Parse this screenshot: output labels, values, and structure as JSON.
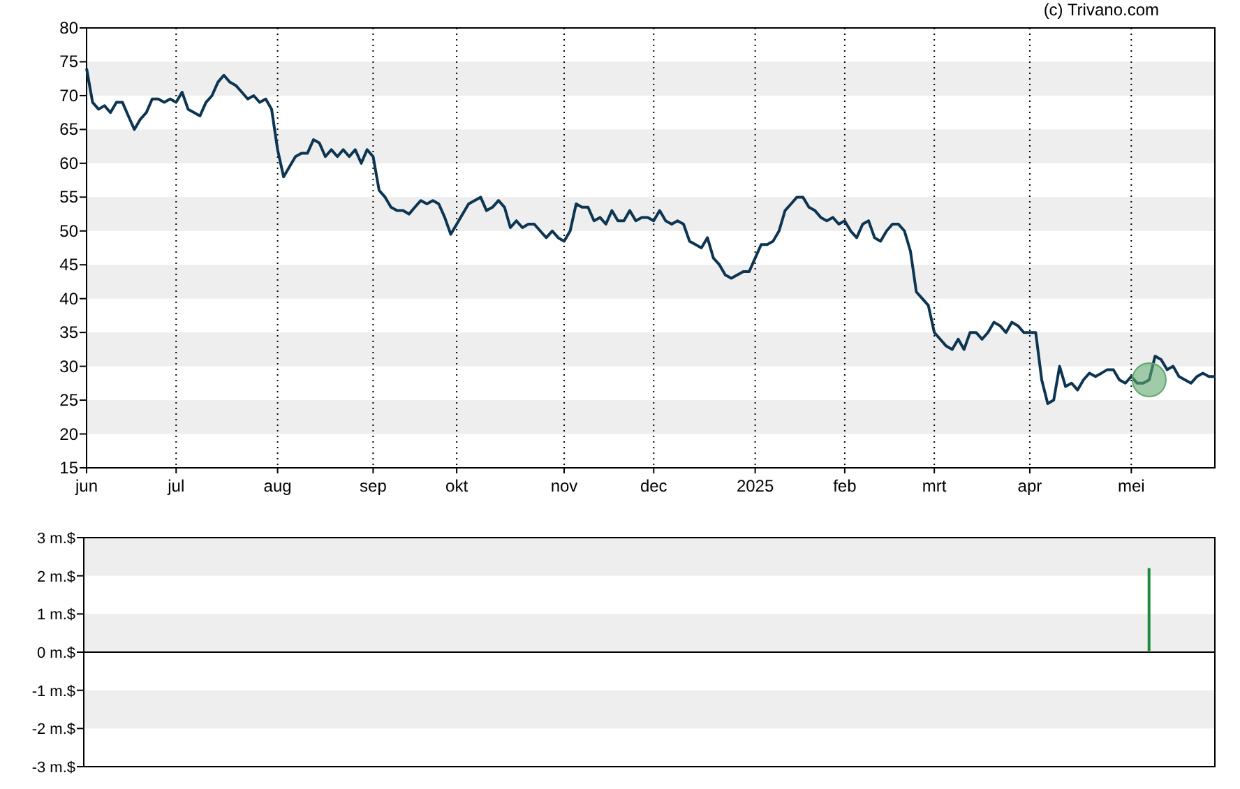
{
  "credit": "(c) Trivano.com",
  "price_chart": {
    "chart_data": {
      "type": "line",
      "ylim": [
        15,
        80
      ],
      "categories": [
        "jun",
        null,
        null,
        null,
        null,
        null,
        null,
        null,
        null,
        null,
        null,
        null,
        null,
        null,
        null,
        "jul",
        null,
        null,
        null,
        null,
        null,
        null,
        null,
        null,
        null,
        null,
        null,
        null,
        null,
        null,
        null,
        null,
        "aug",
        null,
        null,
        null,
        null,
        null,
        null,
        null,
        null,
        null,
        null,
        null,
        null,
        null,
        null,
        null,
        "sep",
        null,
        null,
        null,
        null,
        null,
        null,
        null,
        null,
        null,
        null,
        null,
        null,
        null,
        "okt",
        null,
        null,
        null,
        null,
        null,
        null,
        null,
        null,
        null,
        null,
        null,
        null,
        null,
        null,
        null,
        null,
        null,
        "nov",
        null,
        null,
        null,
        null,
        null,
        null,
        null,
        null,
        null,
        null,
        null,
        null,
        null,
        null,
        "dec",
        null,
        null,
        null,
        null,
        null,
        null,
        null,
        null,
        null,
        null,
        null,
        null,
        null,
        null,
        null,
        null,
        "2025",
        null,
        null,
        null,
        null,
        null,
        null,
        null,
        null,
        null,
        null,
        null,
        null,
        null,
        null,
        "feb",
        null,
        null,
        null,
        null,
        null,
        null,
        null,
        null,
        null,
        null,
        null,
        null,
        null,
        null,
        "mrt",
        null,
        null,
        null,
        null,
        null,
        null,
        null,
        null,
        null,
        null,
        null,
        null,
        null,
        null,
        null,
        "apr",
        null,
        null,
        null,
        null,
        null,
        null,
        null,
        null,
        null,
        null,
        null,
        null,
        null,
        null,
        null,
        null,
        "mei",
        null,
        null,
        null,
        null,
        null,
        null,
        null,
        null,
        null,
        null,
        null,
        null,
        null,
        null
      ],
      "series": [
        {
          "color": "#0d3552",
          "values": [
            74,
            69,
            68,
            68.5,
            67.5,
            69,
            69,
            67,
            65,
            66.5,
            67.5,
            69.5,
            69.5,
            69,
            69.5,
            69,
            70.5,
            68,
            67.5,
            67,
            69,
            70,
            72,
            73,
            72,
            71.5,
            70.5,
            69.5,
            70,
            69,
            69.5,
            68,
            62,
            58,
            59.5,
            61,
            61.5,
            61.5,
            63.5,
            63,
            61,
            62,
            61,
            62,
            61,
            62,
            60,
            62,
            61,
            56,
            55,
            53.5,
            53,
            53,
            52.5,
            53.5,
            54.5,
            54,
            54.5,
            54,
            52,
            49.5,
            51,
            52.5,
            54,
            54.5,
            55,
            53,
            53.5,
            54.5,
            53.5,
            50.5,
            51.5,
            50.5,
            51,
            51,
            50,
            49,
            50,
            49,
            48.5,
            50,
            54,
            53.5,
            53.5,
            51.5,
            52,
            51,
            53,
            51.5,
            51.5,
            53,
            51.5,
            52,
            52,
            51.5,
            53,
            51.5,
            51,
            51.5,
            51,
            48.5,
            48,
            47.5,
            49,
            46,
            45,
            43.5,
            43,
            43.5,
            44,
            44,
            46,
            48,
            48,
            48.5,
            50,
            53,
            54,
            55,
            55,
            53.5,
            53,
            52,
            51.5,
            52,
            51,
            51.5,
            50,
            49,
            51,
            51.5,
            49,
            48.5,
            50,
            51,
            51,
            50,
            47,
            41,
            40,
            39,
            35,
            34,
            33,
            32.5,
            34,
            32.5,
            35,
            35,
            34,
            35,
            36.5,
            36,
            35,
            36.5,
            36,
            35,
            35,
            35,
            28,
            24.5,
            25,
            30,
            27,
            27.5,
            26.5,
            28,
            29,
            28.5,
            29,
            29.5,
            29.5,
            28,
            27.5,
            28.5,
            27.5,
            27.5,
            28,
            31.5,
            31,
            29.5,
            30,
            28.5,
            28,
            27.5,
            28.5,
            29,
            28.5,
            28.5
          ]
        }
      ],
      "yticks": [
        15,
        20,
        25,
        30,
        35,
        40,
        45,
        50,
        55,
        60,
        65,
        70,
        75,
        80
      ]
    }
  },
  "volume_chart": {
    "chart_data": {
      "type": "bar",
      "ylim": [
        -3,
        3
      ],
      "categories": [
        null,
        null,
        null,
        null,
        null,
        null,
        null,
        null,
        null,
        null,
        null,
        null,
        null,
        null,
        null,
        null,
        null,
        null,
        null,
        null,
        null,
        null,
        null,
        null,
        null,
        null,
        null,
        null,
        null,
        null,
        null,
        null,
        null,
        null,
        null,
        null,
        null,
        null,
        null,
        null,
        null,
        null,
        null,
        null,
        null,
        null,
        null,
        null,
        null,
        null,
        null,
        null,
        null,
        null,
        null,
        null,
        null,
        null,
        null,
        null,
        null,
        null,
        null,
        null,
        null,
        null,
        null,
        null,
        null,
        null,
        null,
        null,
        null,
        null,
        null,
        null,
        null,
        null,
        null,
        null,
        null,
        null,
        null,
        null,
        null,
        null,
        null,
        null,
        null,
        null,
        null,
        null,
        null,
        null,
        null,
        null,
        null,
        null,
        null,
        null,
        null,
        null,
        null,
        null,
        null,
        null,
        null,
        null,
        null,
        null,
        null,
        null,
        null,
        null,
        null,
        null,
        null,
        null,
        null,
        null,
        null,
        null,
        null,
        null,
        null,
        null,
        null,
        null,
        null,
        null,
        null,
        null,
        null,
        null,
        null,
        null,
        null,
        null,
        null,
        null,
        null,
        null,
        null,
        null,
        null,
        null,
        null,
        null,
        null,
        null,
        null,
        null,
        null,
        null,
        null,
        null,
        null,
        null,
        null,
        null,
        null,
        null,
        null,
        null,
        null,
        null,
        null,
        null,
        null,
        null,
        null,
        null,
        null,
        null,
        null,
        null,
        null,
        null,
        null,
        null,
        null,
        null,
        null,
        null,
        null,
        null,
        null,
        null,
        null,
        null
      ],
      "series": [
        {
          "color": "#1e8a3e",
          "values": [
            null,
            null,
            null,
            null,
            null,
            null,
            null,
            null,
            null,
            null,
            null,
            null,
            null,
            null,
            null,
            null,
            null,
            null,
            null,
            null,
            null,
            null,
            null,
            null,
            null,
            null,
            null,
            null,
            null,
            null,
            null,
            null,
            null,
            null,
            null,
            null,
            null,
            null,
            null,
            null,
            null,
            null,
            null,
            null,
            null,
            null,
            null,
            null,
            null,
            null,
            null,
            null,
            null,
            null,
            null,
            null,
            null,
            null,
            null,
            null,
            null,
            null,
            null,
            null,
            null,
            null,
            null,
            null,
            null,
            null,
            null,
            null,
            null,
            null,
            null,
            null,
            null,
            null,
            null,
            null,
            null,
            null,
            null,
            null,
            null,
            null,
            null,
            null,
            null,
            null,
            null,
            null,
            null,
            null,
            null,
            null,
            null,
            null,
            null,
            null,
            null,
            null,
            null,
            null,
            null,
            null,
            null,
            null,
            null,
            null,
            null,
            null,
            null,
            null,
            null,
            null,
            null,
            null,
            null,
            null,
            null,
            null,
            null,
            null,
            null,
            null,
            null,
            null,
            null,
            null,
            null,
            null,
            null,
            null,
            null,
            null,
            null,
            null,
            null,
            null,
            null,
            null,
            null,
            null,
            null,
            null,
            null,
            null,
            null,
            null,
            null,
            null,
            null,
            null,
            null,
            null,
            null,
            null,
            null,
            null,
            null,
            null,
            null,
            null,
            null,
            null,
            null,
            null,
            null,
            null,
            null,
            null,
            null,
            null,
            null,
            null,
            null,
            null,
            2.2,
            null,
            null,
            null,
            null,
            null,
            null,
            null,
            null,
            null,
            null,
            null
          ]
        }
      ],
      "yticks": [
        {
          "value": -3,
          "label": "-3 m.$"
        },
        {
          "value": -2,
          "label": "-2 m.$"
        },
        {
          "value": -1,
          "label": "-1 m.$"
        },
        {
          "value": 0,
          "label": "0 m.$"
        },
        {
          "value": 1,
          "label": "1 m.$"
        },
        {
          "value": 2,
          "label": "2 m.$"
        },
        {
          "value": 3,
          "label": "3 m.$"
        }
      ]
    }
  }
}
